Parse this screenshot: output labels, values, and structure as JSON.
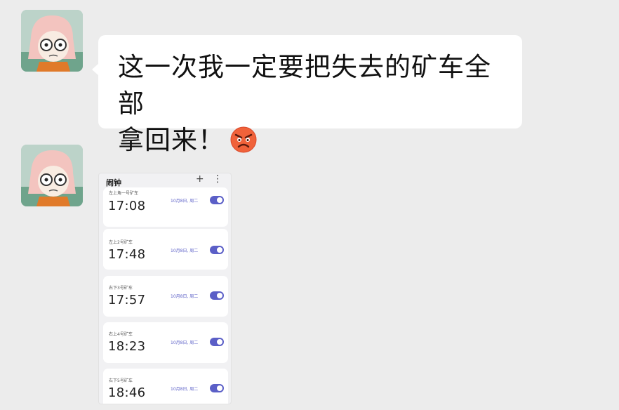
{
  "messages": [
    {
      "type": "text",
      "line1": "这一次我一定要把失去的矿车全部",
      "line2": "拿回来！",
      "emoji": "angry-face-icon"
    },
    {
      "type": "image",
      "screenshot": {
        "title": "闹钟",
        "add_icon": "+",
        "more_icon": "⋮",
        "alarms": [
          {
            "label": "左上角一号矿车",
            "time": "17:08",
            "date": "10月8日, 周二",
            "enabled": true
          },
          {
            "label": "左上2号矿车",
            "time": "17:48",
            "date": "10月8日, 周二",
            "enabled": true
          },
          {
            "label": "右下3号矿车",
            "time": "17:57",
            "date": "10月8日, 周二",
            "enabled": true
          },
          {
            "label": "右上4号矿车",
            "time": "18:23",
            "date": "10月8日, 周二",
            "enabled": true
          },
          {
            "label": "右下5号矿车",
            "time": "18:46",
            "date": "10月8日, 周二",
            "enabled": true
          }
        ]
      }
    }
  ],
  "colors": {
    "background": "#ececec",
    "bubble": "#ffffff",
    "toggle_on": "#5b5fc7"
  }
}
